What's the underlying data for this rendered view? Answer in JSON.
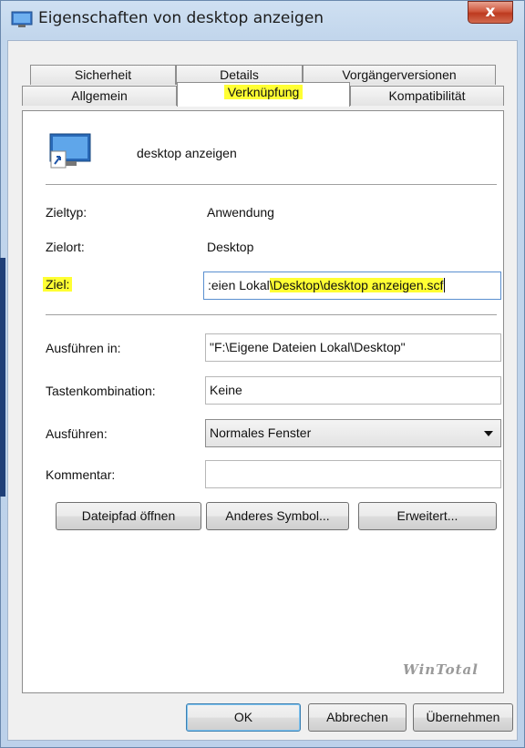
{
  "window": {
    "title": "Eigenschaften von desktop anzeigen",
    "close_glyph": "x"
  },
  "tabs": {
    "row1": [
      "Sicherheit",
      "Details",
      "Vorgängerversionen"
    ],
    "row2": [
      "Allgemein",
      "Verknüpfung",
      "Kompatibilität"
    ],
    "active": "Verknüpfung"
  },
  "shortcut": {
    "name": "desktop anzeigen",
    "icon": "desktop-shortcut-icon"
  },
  "fields": {
    "zieltyp_label": "Zieltyp:",
    "zieltyp_value": "Anwendung",
    "zielort_label": "Zielort:",
    "zielort_value": "Desktop",
    "ziel_label": "Ziel:",
    "ziel_value_plain": ":eien Lokal",
    "ziel_value_highlight": "\\Desktop\\desktop anzeigen.scf",
    "ausfuehren_in_label": "Ausführen in:",
    "ausfuehren_in_value": "\"F:\\Eigene Dateien Lokal\\Desktop\"",
    "tastenkombination_label": "Tastenkombination:",
    "tastenkombination_value": "Keine",
    "ausfuehren_label": "Ausführen:",
    "ausfuehren_value": "Normales Fenster",
    "kommentar_label": "Kommentar:",
    "kommentar_value": ""
  },
  "buttons": {
    "dateipfad": "Dateipfad öffnen",
    "symbol": "Anderes Symbol...",
    "erweitert": "Erweitert...",
    "ok": "OK",
    "abbrechen": "Abbrechen",
    "uebernehmen": "Übernehmen"
  },
  "watermark": "WinTotal",
  "colors": {
    "highlight": "#ffff33",
    "frame": "#c2d6ec",
    "close": "#c9452a"
  }
}
